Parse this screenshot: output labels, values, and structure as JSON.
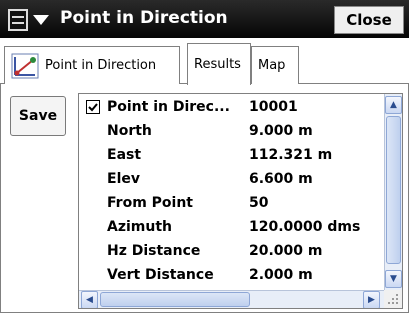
{
  "window": {
    "title": "Point in Direction",
    "close_label": "Close"
  },
  "tabs": [
    {
      "label": "Point in Direction"
    },
    {
      "label": "Results"
    },
    {
      "label": "Map"
    }
  ],
  "active_tab": "Results",
  "toolbar": {
    "save_label": "Save"
  },
  "results": {
    "rows": [
      {
        "key": "Point in Direc...",
        "value": "10001",
        "checked": true
      },
      {
        "key": "North",
        "value": "9.000 m"
      },
      {
        "key": "East",
        "value": "112.321 m"
      },
      {
        "key": "Elev",
        "value": "6.600 m"
      },
      {
        "key": "From Point",
        "value": "50"
      },
      {
        "key": "Azimuth",
        "value": "120.0000 dms"
      },
      {
        "key": "Hz Distance",
        "value": "20.000 m"
      },
      {
        "key": "Vert Distance",
        "value": "2.000 m"
      }
    ]
  },
  "icons": {
    "menu": "document-menu-icon",
    "tab": "point-direction-icon",
    "check": "checkmark-icon"
  },
  "colors": {
    "titlebar": "#0a0a0a",
    "scrollbar": "#bfd0ee"
  }
}
